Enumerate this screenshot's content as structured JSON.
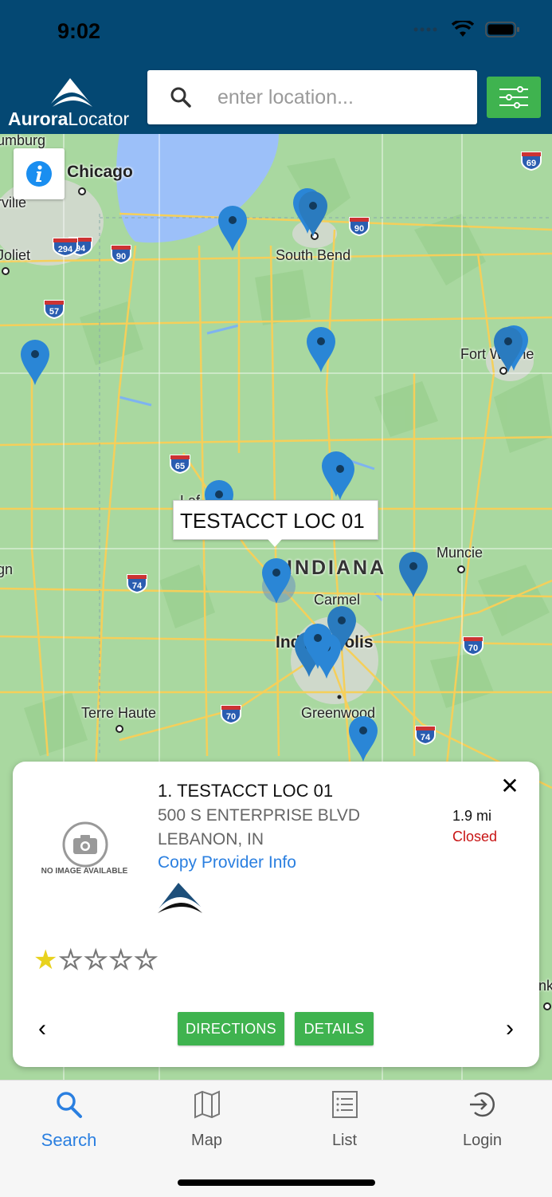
{
  "status_bar": {
    "time": "9:02"
  },
  "header": {
    "logo_bold": "Aurora",
    "logo_light": "Locator",
    "search_placeholder": "enter location..."
  },
  "map": {
    "labels": {
      "chicago": "Chicago",
      "south_bend": "South Bend",
      "fort_wayne": "Fort Wayne",
      "muncie": "Muncie",
      "indiana": "INDIANA",
      "carmel": "Carmel",
      "indianapolis": "Indianapolis",
      "terre_haute": "Terre Haute",
      "greenwood": "Greenwood",
      "joliet": "Joliet",
      "rville": "rville",
      "umburg": "umburg",
      "gn": "gn",
      "laf": "Laf",
      "nk": "nk"
    },
    "shields": [
      "94",
      "90",
      "294",
      "57",
      "65",
      "74",
      "70",
      "70",
      "74",
      "69",
      "90"
    ],
    "callout": "TESTACCT LOC 01"
  },
  "card": {
    "title": "1.  TESTACCT LOC 01",
    "address_line1": "500 S ENTERPRISE BLVD",
    "address_line2": "LEBANON, IN",
    "copy_link": "Copy Provider Info",
    "distance": "1.9 mi",
    "status": "Closed",
    "no_image_text": "NO IMAGE AVAILABLE",
    "rating": 1,
    "rating_max": 5,
    "directions_label": "DIRECTIONS",
    "details_label": "DETAILS",
    "close_symbol": "✕",
    "prev_symbol": "‹",
    "next_symbol": "›",
    "star_filled": "★",
    "star_empty": "☆"
  },
  "tabs": [
    {
      "label": "Search",
      "icon": "search-icon",
      "active": true
    },
    {
      "label": "Map",
      "icon": "map-icon",
      "active": false
    },
    {
      "label": "List",
      "icon": "list-icon",
      "active": false
    },
    {
      "label": "Login",
      "icon": "login-icon",
      "active": false
    }
  ],
  "colors": {
    "header": "#044873",
    "green": "#3fb34f",
    "link": "#2a7fe0",
    "closed": "#c81414",
    "pin": "#2a86d6"
  }
}
